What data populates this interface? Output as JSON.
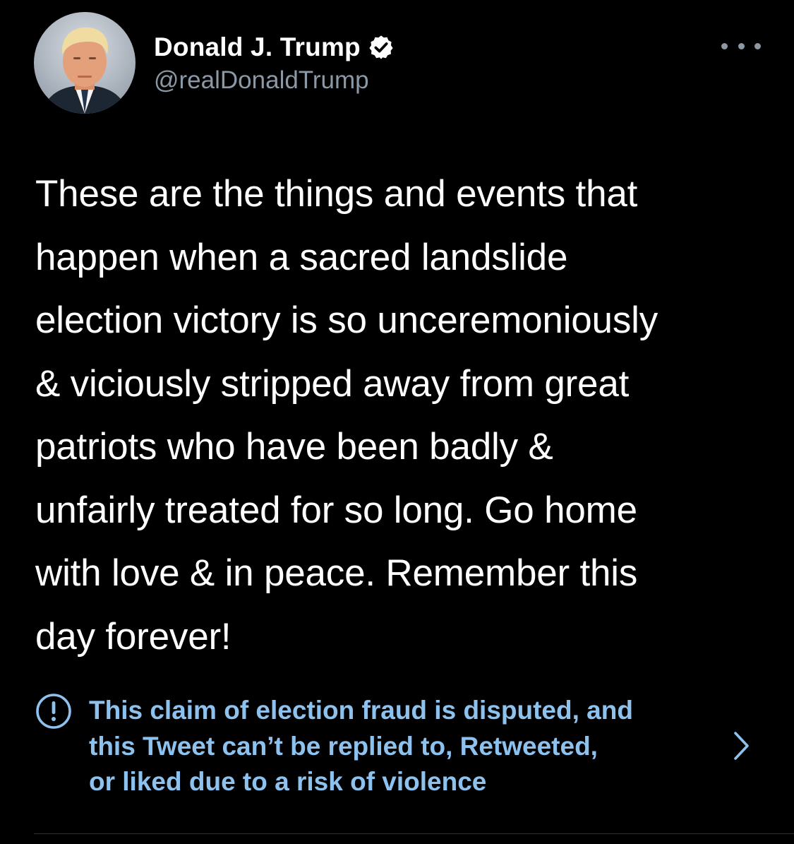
{
  "user": {
    "display_name": "Donald J. Trump",
    "handle": "@realDonaldTrump",
    "verified_icon": "verified-badge-icon",
    "avatar_icon": "profile-photo"
  },
  "more_icon": "more-options-icon",
  "tweet": {
    "text": "These are the things and events that\nhappen when a sacred landslide\nelection victory is so unceremoniously\n& viciously stripped away from great\npatriots who have been badly &\nunfairly treated for so long. Go home\nwith love & in peace. Remember this\nday forever!"
  },
  "notice": {
    "icon": "exclamation-circle-icon",
    "text": "This claim of election fraud is disputed, and\nthis Tweet can’t be replied to, Retweeted,\nor liked due to a risk of violence",
    "chevron_icon": "chevron-right-icon"
  },
  "colors": {
    "background": "#000000",
    "primary_text": "#ffffff",
    "secondary_text": "#8b98a5",
    "notice_text": "#8ec2ee",
    "divider": "#2f3336"
  }
}
